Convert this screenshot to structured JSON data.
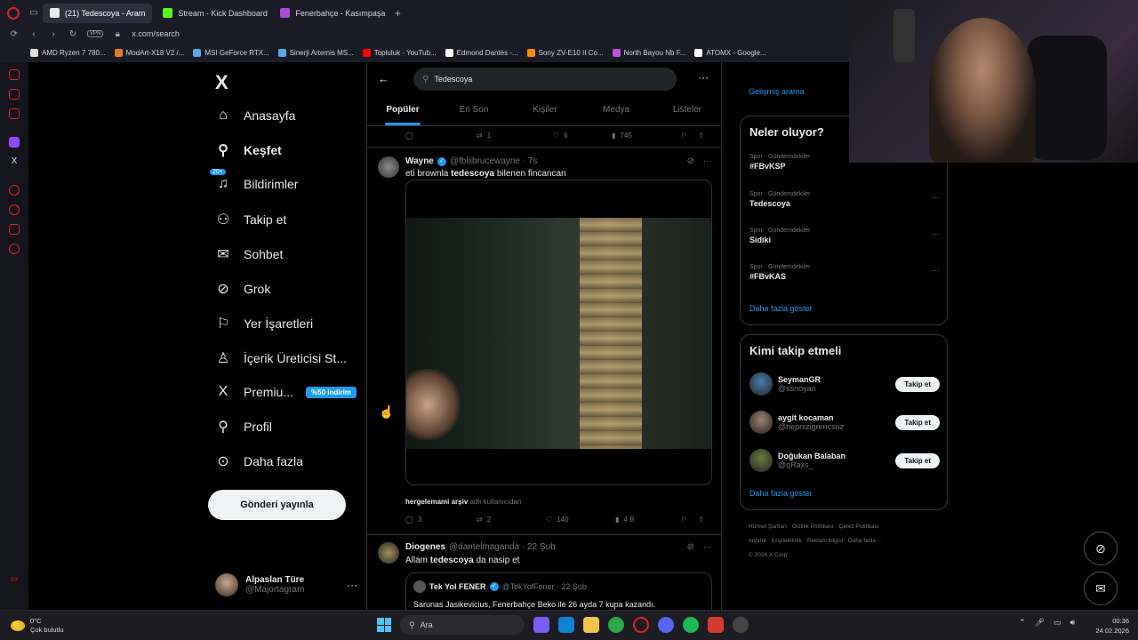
{
  "browser": {
    "tabs": [
      {
        "label": "(21) Tedescoya - Aram",
        "active": true,
        "color": "#e7e9ea"
      },
      {
        "label": "Stream - Kick Dashboard",
        "active": false,
        "color": "#53fc18"
      },
      {
        "label": "Fenerbahçe - Kasımpaşa M",
        "active": false,
        "color": "#a84bd8"
      }
    ],
    "new_tab": "+",
    "vpn": "VPN",
    "url": "x.com/search",
    "bookmarks": [
      {
        "label": "AMD Ryzen 7 780...",
        "color": "#ddd"
      },
      {
        "label": "ModArt-X18 V2 /...",
        "color": "#e07b28"
      },
      {
        "label": "MSI GeForce RTX...",
        "color": "#5aa9e6"
      },
      {
        "label": "Sinerji Artemis MS...",
        "color": "#5aa9e6"
      },
      {
        "label": "Topluluk - YouTub...",
        "color": "#ff0000"
      },
      {
        "label": "Edmond Dantès -...",
        "color": "#ffffff"
      },
      {
        "label": "Sony ZV-E10 II Co...",
        "color": "#ff8c00"
      },
      {
        "label": "North Bayou Nb F...",
        "color": "#c04fd9"
      },
      {
        "label": "ATOMX - Google...",
        "color": "#ffffff"
      }
    ]
  },
  "x": {
    "logo": "X",
    "nav": [
      {
        "label": "Anasayfa",
        "icon": "home-icon",
        "glyph": "⌂"
      },
      {
        "label": "Keşfet",
        "icon": "search-icon",
        "glyph": "⚲",
        "bold": true
      },
      {
        "label": "Bildirimler",
        "icon": "bell-icon",
        "glyph": "♫",
        "badge": "20+"
      },
      {
        "label": "Takip et",
        "icon": "person-add-icon",
        "glyph": "⚇"
      },
      {
        "label": "Sohbet",
        "icon": "mail-icon",
        "glyph": "✉"
      },
      {
        "label": "Grok",
        "icon": "grok-icon",
        "glyph": "⊘"
      },
      {
        "label": "Yer İşaretleri",
        "icon": "bookmark-icon",
        "glyph": "⚐"
      },
      {
        "label": "İçerik Üreticisi St...",
        "icon": "creator-studio-icon",
        "glyph": "♙"
      },
      {
        "label": "Premiu...",
        "icon": "x-premium-icon",
        "glyph": "X",
        "badge": "%50 indirim"
      },
      {
        "label": "Profil",
        "icon": "profile-icon",
        "glyph": "⚲"
      },
      {
        "label": "Daha fazla",
        "icon": "more-circle-icon",
        "glyph": "⊙"
      }
    ],
    "post_button": "Gönderi yayınla",
    "account": {
      "name": "Alpaslan Türe",
      "handle": "@Majortagram",
      "more": "···"
    }
  },
  "search": {
    "query": "Tedescoya",
    "back": "←",
    "more": "···",
    "tabs": [
      "Popüler",
      "En Son",
      "Kişiler",
      "Medya",
      "Listeler"
    ],
    "active_tab": "Popüler"
  },
  "top_actions": {
    "replies": "",
    "reposts": "1",
    "likes": "6",
    "views": "745"
  },
  "tweets": [
    {
      "name": "Wayne",
      "handle": "@fbliibrucewayne · 7s",
      "text_before": "eti brownla ",
      "text_bold": "tedescoya",
      "text_after": " bilenen fincancan",
      "caption_user": "hergelemami arşiv",
      "caption_rest": " adlı kullanıcıdan",
      "actions": {
        "replies": "3",
        "reposts": "2",
        "likes": "140",
        "views": "4 B"
      }
    },
    {
      "name": "Diogenes",
      "handle": "@dantelmaganda · 22 Şub",
      "text_before": "Allam ",
      "text_bold": "tedescoya",
      "text_after": " da nasip et",
      "quote": {
        "name": "Tek Yol FENER",
        "handle": "@TekYolFener · 22 Şub",
        "text": "Sarunas Jasikevicius, Fenerbahçe Beko ile 26 ayda 7 kupa kazandı."
      }
    }
  ],
  "right": {
    "advanced_search": "Gelişmiş arama",
    "trends_title": "Neler oluyor?",
    "trends": [
      {
        "category": "Spor · Gündemdekiler",
        "topic": "#FBvKSP"
      },
      {
        "category": "Spor · Gündemdekiler",
        "topic": "Tedescoya"
      },
      {
        "category": "Spor · Gündemdekiler",
        "topic": "Sidiki"
      },
      {
        "category": "Spor · Gündemdekiler",
        "topic": "#FBvKAS"
      }
    ],
    "trends_more": "Daha fazla göster",
    "who_title": "Kimi takip etmeli",
    "who": [
      {
        "name": "SeymanGR",
        "handle": "@ssnoyan",
        "button": "Takip et",
        "color": "#4a7fb0"
      },
      {
        "name": "aygit kocaman",
        "handle": "@hepnizigrencsnz",
        "button": "Takip et",
        "color": "#a08070"
      },
      {
        "name": "Doğukan Balaban",
        "handle": "@qRaxs_",
        "button": "Takip et",
        "color": "#6a7a40"
      }
    ],
    "who_more": "Daha fazla göster",
    "footer": [
      "Hizmet Şartları",
      "Gizlilik Politikası",
      "Çerez Politikası",
      "Imprint",
      "Erişilebilirlik",
      "Reklam bilgisi",
      "Daha fazla ···",
      "© 2026 X Corp."
    ]
  },
  "taskbar": {
    "temp": "0°C",
    "weather": "Çok bulutlu",
    "search": "Ara",
    "time": "00:36",
    "date": "24.02.2026"
  }
}
